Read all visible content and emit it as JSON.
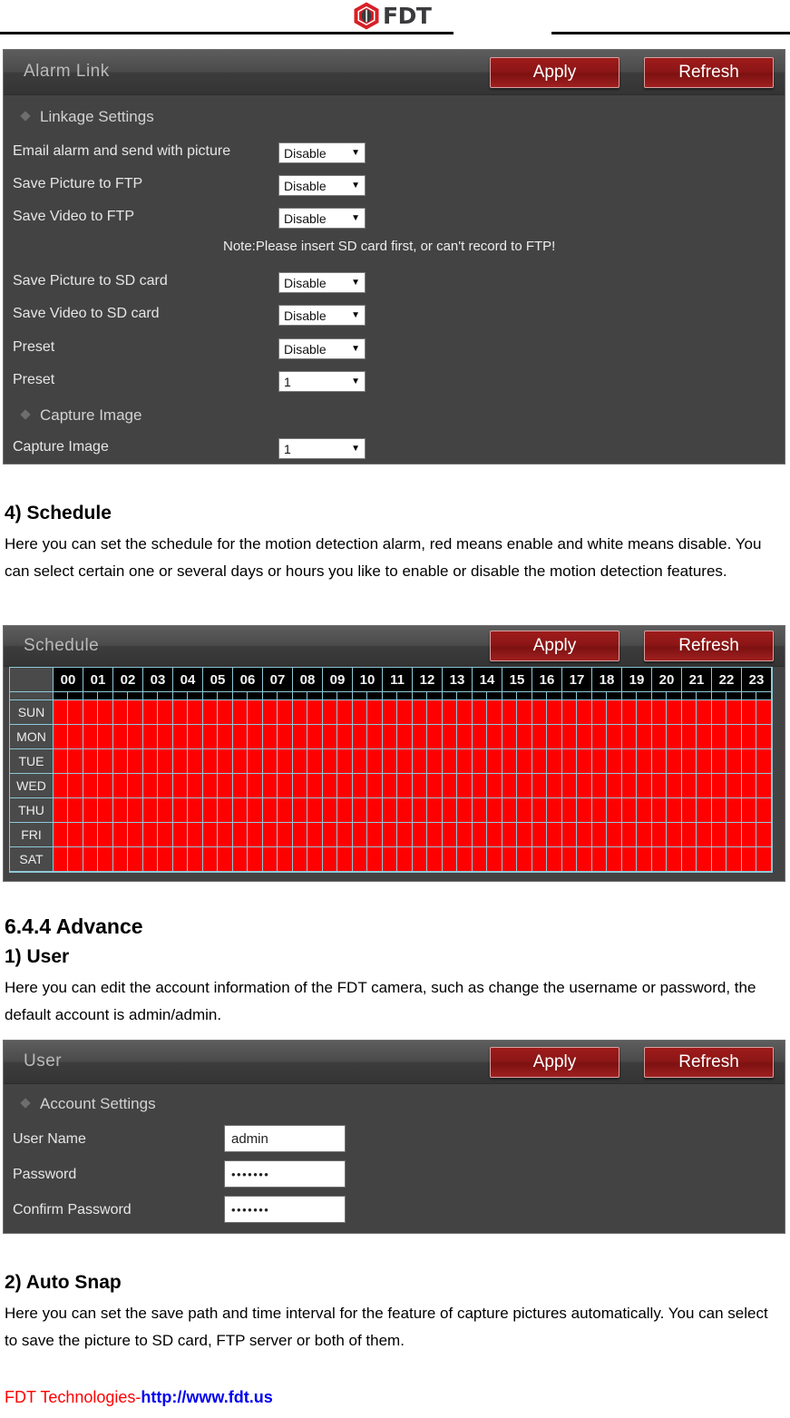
{
  "header": {
    "logo_icon": "fdt-hexagon-logo-icon",
    "logo_text": "FDT"
  },
  "alarm_panel": {
    "title": "Alarm Link",
    "apply_label": "Apply",
    "refresh_label": "Refresh",
    "section_linkage": "Linkage Settings",
    "section_capture": "Capture Image",
    "note": "Note:Please insert SD card first, or can't record to FTP!",
    "rows": [
      {
        "label": "Email alarm and send with picture",
        "value": "Disable"
      },
      {
        "label": "Save Picture to FTP",
        "value": "Disable"
      },
      {
        "label": "Save Video to FTP",
        "value": "Disable"
      },
      {
        "label": "Save Picture to SD card",
        "value": "Disable"
      },
      {
        "label": "Save Video to SD card",
        "value": "Disable"
      },
      {
        "label": "Preset",
        "value": "Disable"
      },
      {
        "label": "Preset",
        "value": "1"
      }
    ],
    "capture_row": {
      "label": "Capture Image",
      "value": "1"
    },
    "dropdown_arrow": "chevron-down-icon"
  },
  "schedule_section": {
    "heading": "4) Schedule",
    "paragraph": "Here you can set the schedule for the motion detection alarm, red means enable and white means disable. You can select certain one or several days or hours you like to enable or disable the motion detection features."
  },
  "schedule_panel": {
    "title": "Schedule",
    "apply_label": "Apply",
    "refresh_label": "Refresh",
    "hours": [
      "00",
      "01",
      "02",
      "03",
      "04",
      "05",
      "06",
      "07",
      "08",
      "09",
      "10",
      "11",
      "12",
      "13",
      "14",
      "15",
      "16",
      "17",
      "18",
      "19",
      "20",
      "21",
      "22",
      "23"
    ],
    "days": [
      "SUN",
      "MON",
      "TUE",
      "WED",
      "THU",
      "FRI",
      "SAT"
    ],
    "enabled_color": "#ff0000",
    "disabled_color": "#ffffff",
    "all_enabled": true
  },
  "advance_section": {
    "heading": "6.4.4 Advance",
    "subheading": "1) User",
    "paragraph": "Here you can edit the account information of the FDT camera, such as change the username or password, the default account is admin/admin."
  },
  "user_panel": {
    "title": "User",
    "apply_label": "Apply",
    "refresh_label": "Refresh",
    "section_account": "Account Settings",
    "fields": [
      {
        "label": "User Name",
        "value": "admin"
      },
      {
        "label": "Password",
        "value": "•••••••"
      },
      {
        "label": "Confirm Password",
        "value": "•••••••"
      }
    ]
  },
  "autosnap_section": {
    "heading": "2) Auto Snap",
    "paragraph": "Here you can set the save path and time interval for the feature of capture pictures automatically. You can select to save the picture to SD card, FTP server or both of them."
  },
  "footer": {
    "company": "FDT Technologies-",
    "url": "http://www.fdt.us"
  },
  "colors": {
    "brand_red": "#d81f26",
    "button_red": "#8d1616",
    "panel_bg": "#434343",
    "grid_line": "#8fc8d8"
  }
}
